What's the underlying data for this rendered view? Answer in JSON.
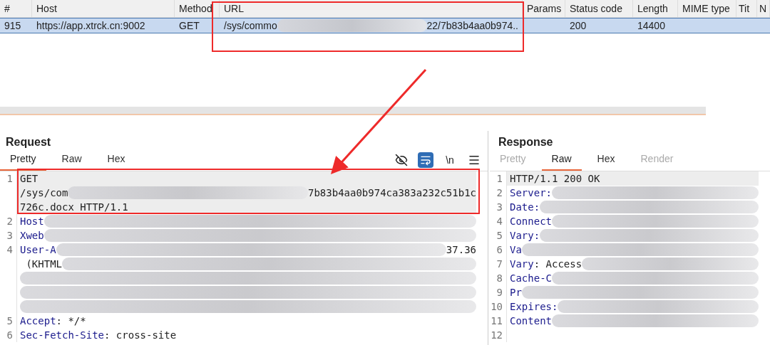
{
  "table": {
    "columns": [
      "#",
      "Host",
      "Method",
      "URL",
      "Params",
      "Status code",
      "Length",
      "MIME type",
      "Tit",
      "N"
    ],
    "rows": [
      {
        "selected": true,
        "cells": [
          {
            "text": "915"
          },
          {
            "text": "https://app.xtrck.cn:9002"
          },
          {
            "text": "GET"
          },
          {
            "text": "/sys/commo",
            "redacted_tail": "22/7b83b4aa0b974.."
          },
          {
            "text": ""
          },
          {
            "text": "200"
          },
          {
            "text": "14400"
          },
          {
            "text": ""
          },
          {
            "text": ""
          },
          {
            "text": ""
          }
        ]
      }
    ]
  },
  "request": {
    "title": "Request",
    "tabs": [
      {
        "label": "Pretty",
        "selected": true,
        "disabled": false
      },
      {
        "label": "Raw",
        "selected": false,
        "disabled": false
      },
      {
        "label": "Hex",
        "selected": false,
        "disabled": false
      }
    ],
    "tools": [
      {
        "kind": "eye-off",
        "selected": false
      },
      {
        "kind": "wrap",
        "selected": true
      },
      {
        "kind": "newline",
        "label": "\\n",
        "selected": false
      },
      {
        "kind": "menu",
        "selected": false
      }
    ],
    "lines": [
      {
        "number": "1",
        "highlighted": true,
        "rows": [
          [
            {
              "kind": "value",
              "text": "GET"
            }
          ],
          [
            {
              "kind": "value",
              "text": "/sys/com"
            },
            {
              "kind": "redacted"
            },
            {
              "kind": "value",
              "text": "7b83b4aa0b974ca383a232c51b1c"
            }
          ],
          [
            {
              "kind": "value",
              "text": "726c.docx HTTP/1.1"
            }
          ]
        ]
      },
      {
        "number": "2",
        "highlighted": false,
        "rows": [
          [
            {
              "kind": "key",
              "text": "Host"
            },
            {
              "kind": "redacted"
            }
          ]
        ]
      },
      {
        "number": "3",
        "highlighted": false,
        "rows": [
          [
            {
              "kind": "key",
              "text": "Xweb"
            },
            {
              "kind": "redacted"
            }
          ]
        ]
      },
      {
        "number": "4",
        "highlighted": false,
        "rows": [
          [
            {
              "kind": "key",
              "text": "User-A"
            },
            {
              "kind": "redacted"
            },
            {
              "kind": "value",
              "text": "37.36"
            }
          ],
          [
            {
              "kind": "value",
              "text": " (KHTML"
            },
            {
              "kind": "redacted"
            }
          ],
          [
            {
              "kind": "redacted"
            }
          ],
          [
            {
              "kind": "redacted"
            }
          ],
          [
            {
              "kind": "redacted"
            }
          ]
        ]
      },
      {
        "number": "5",
        "highlighted": false,
        "rows": [
          [
            {
              "kind": "key",
              "text": "Accept"
            },
            {
              "kind": "value",
              "text": ": */*"
            }
          ]
        ]
      },
      {
        "number": "6",
        "highlighted": false,
        "rows": [
          [
            {
              "kind": "key",
              "text": "Sec-Fetch-Site"
            },
            {
              "kind": "value",
              "text": ": cross-site"
            }
          ]
        ]
      }
    ]
  },
  "response": {
    "title": "Response",
    "tabs": [
      {
        "label": "Pretty",
        "selected": false,
        "disabled": true
      },
      {
        "label": "Raw",
        "selected": true,
        "disabled": false
      },
      {
        "label": "Hex",
        "selected": false,
        "disabled": false
      },
      {
        "label": "Render",
        "selected": false,
        "disabled": true
      }
    ],
    "lines": [
      {
        "number": "1",
        "highlighted": true,
        "rows": [
          [
            {
              "kind": "value",
              "text": "HTTP/1.1 200 OK"
            }
          ]
        ]
      },
      {
        "number": "2",
        "highlighted": false,
        "rows": [
          [
            {
              "kind": "key",
              "text": "Server:"
            },
            {
              "kind": "redacted"
            }
          ]
        ]
      },
      {
        "number": "3",
        "highlighted": false,
        "rows": [
          [
            {
              "kind": "key",
              "text": "Date:"
            },
            {
              "kind": "redacted"
            }
          ]
        ]
      },
      {
        "number": "4",
        "highlighted": false,
        "rows": [
          [
            {
              "kind": "key",
              "text": "Connect"
            },
            {
              "kind": "redacted"
            }
          ]
        ]
      },
      {
        "number": "5",
        "highlighted": false,
        "rows": [
          [
            {
              "kind": "key",
              "text": "Vary:"
            },
            {
              "kind": "redacted"
            }
          ]
        ]
      },
      {
        "number": "6",
        "highlighted": false,
        "rows": [
          [
            {
              "kind": "key",
              "text": "Va"
            },
            {
              "kind": "redacted"
            }
          ]
        ]
      },
      {
        "number": "7",
        "highlighted": false,
        "rows": [
          [
            {
              "kind": "key",
              "text": "Vary"
            },
            {
              "kind": "value",
              "text": ": Access"
            },
            {
              "kind": "redacted"
            }
          ]
        ]
      },
      {
        "number": "8",
        "highlighted": false,
        "rows": [
          [
            {
              "kind": "key",
              "text": "Cache-C"
            },
            {
              "kind": "redacted"
            }
          ]
        ]
      },
      {
        "number": "9",
        "highlighted": false,
        "rows": [
          [
            {
              "kind": "key",
              "text": "Pr"
            },
            {
              "kind": "redacted"
            }
          ]
        ]
      },
      {
        "number": "10",
        "highlighted": false,
        "rows": [
          [
            {
              "kind": "key",
              "text": "Expires:"
            },
            {
              "kind": "redacted"
            }
          ]
        ]
      },
      {
        "number": "11",
        "highlighted": false,
        "rows": [
          [
            {
              "kind": "key",
              "text": "Content"
            },
            {
              "kind": "redacted"
            }
          ]
        ]
      },
      {
        "number": "12",
        "highlighted": false,
        "rows": [
          []
        ]
      }
    ]
  }
}
